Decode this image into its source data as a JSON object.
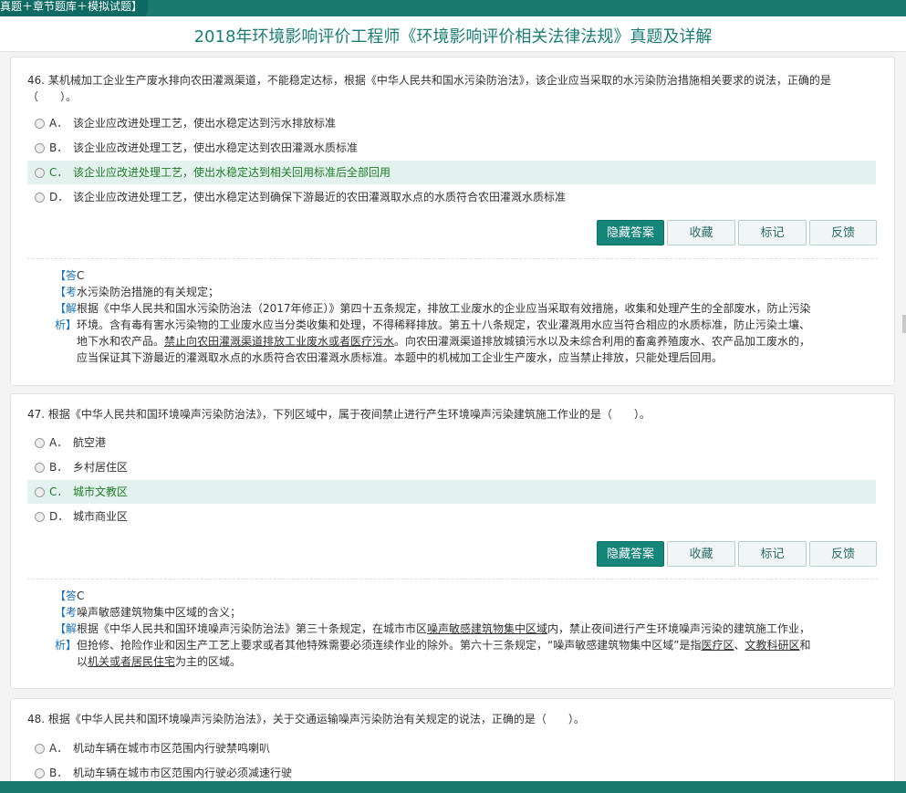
{
  "header": {
    "breadcrumb": "真题＋章节题库＋模拟试题】",
    "title": "2018年环境影响评价工程师《环境影响评价相关法律法规》真题及详解"
  },
  "buttons": {
    "hide": "隐藏答案",
    "collect": "收藏",
    "mark": "标记",
    "feedback": "反馈"
  },
  "questions": [
    {
      "stem_line1": "46. 某机械加工企业生产废水排向农田灌溉渠道，不能稳定达标，根据《中华人民共和国水污染防治法》，该企业应当采取的水污染防治措施相关要求的说法，正确的是",
      "stem_line2": "（　　）。",
      "options": [
        {
          "letter": "A．",
          "text": "该企业应改进处理工艺，使出水稳定达到污水排放标准"
        },
        {
          "letter": "B．",
          "text": "该企业应改进处理工艺，使出水稳定达到农田灌溉水质标准"
        },
        {
          "letter": "C．",
          "text": "该企业应改进处理工艺，使出水稳定达到相关回用标准后全部回用"
        },
        {
          "letter": "D．",
          "text": "该企业应改进处理工艺，使出水稳定达到确保下游最近的农田灌溉取水点的水质符合农田灌溉水质标准"
        }
      ],
      "answer_label": "【答",
      "answer_value": "C",
      "point_label": "【考",
      "point_text": "水污染防治措施的有关规定；",
      "analysis_label1": "【解",
      "analysis_label2": "析】",
      "analysis_lines": [
        "根据《中华人民共和国水污染防治法（2017年修正）》第四十五条规定，排放工业废水的企业应当采取有效措施，收集和处理产生的全部废水，防止污染",
        "环境。含有毒有害水污染物的工业废水应当分类收集和处理，不得稀释排放。第五十八条规定，农业灌溉用水应当符合相应的水质标准，防止污染土壤、",
        "地下水和农产品。",
        "禁止向农田灌溉渠道排放工业废水或者医疗污水",
        "。向农田灌溉渠道排放城镇污水以及未综合利用的畜禽养殖废水、农产品加工废水的，",
        "应当保证其下游最近的灌溉取水点的水质符合农田灌溉水质标准。本题中的机械加工企业生产废水，应当禁止排放，只能处理后回用。"
      ]
    },
    {
      "stem_line1": "47. 根据《中华人民共和国环境噪声污染防治法》，下列区域中，属于夜间禁止进行产生环境噪声污染建筑施工作业的是（　　）。",
      "options": [
        {
          "letter": "A．",
          "text": "航空港"
        },
        {
          "letter": "B．",
          "text": "乡村居住区"
        },
        {
          "letter": "C．",
          "text": "城市文教区"
        },
        {
          "letter": "D．",
          "text": "城市商业区"
        }
      ],
      "answer_label": "【答",
      "answer_value": "C",
      "point_label": "【考",
      "point_text": "噪声敏感建筑物集中区域的含义；",
      "analysis_label1": "【解",
      "analysis_label2": "析】",
      "analysis_lines": [
        "根据《中华人民共和国环境噪声污染防治法》第三十条规定，在城市市区",
        "噪声敏感建筑物集中区域",
        "内，禁止夜间进行产生环境噪声污染的建筑施工作业，",
        "但抢修、抢险作业和因生产工艺上要求或者其他特殊需要必须连续作业的除外。第六十三条规定，“噪声敏感建筑物集中区域”是指",
        "医疗区",
        "、",
        "文教科研区",
        "和",
        "以",
        "机关或者居民住宅",
        "为主的区域。"
      ]
    },
    {
      "stem_line1": "48. 根据《中华人民共和国环境噪声污染防治法》，关于交通运输噪声污染防治有关规定的说法，正确的是（　　）。",
      "options": [
        {
          "letter": "A．",
          "text": "机动车辆在城市市区范围内行驶禁鸣喇叭"
        },
        {
          "letter": "B．",
          "text": "机动车辆在城市市区范围内行驶必须减速行驶"
        }
      ]
    }
  ]
}
